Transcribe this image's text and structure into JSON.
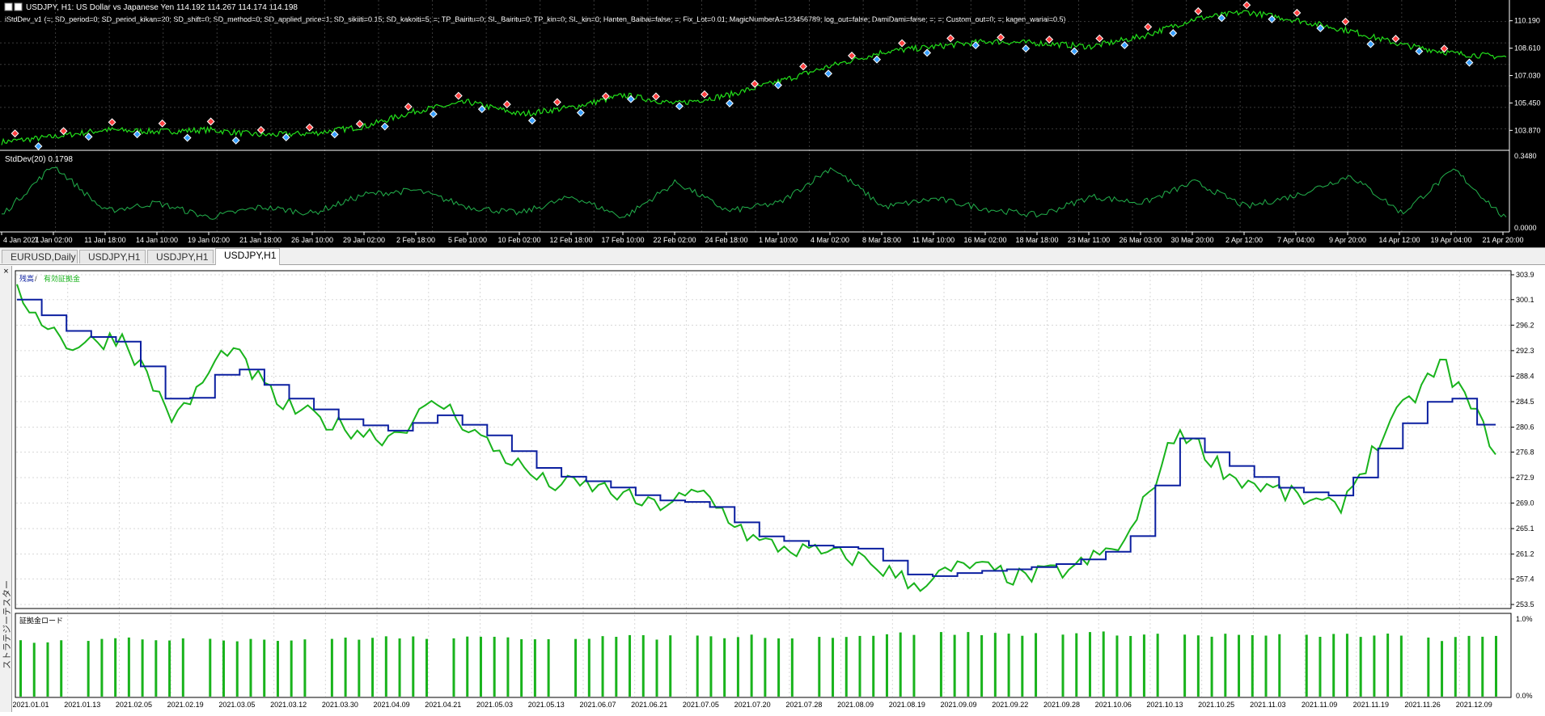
{
  "top_chart": {
    "header_line1": "USDJPY, H1:  US Dollar vs Japanese Yen  114.192 114.267 114.174 114.198",
    "header_line2": "iStdDev_v1 (=; SD_period=0; SD_period_kikan=20; SD_shift=0; SD_method=0; SD_applied_price=1; SD_sikiiti=0.15; SD_kakoiti=5; =; TP_Bairitu=0; SL_Bairitu=0; TP_kin=0; SL_kin=0; Hanten_Baibai=false; =; Fix_Lot=0.01; MagicNumberA=123456789; log_out=false; DamiDami=false; =; =; Custom_out=0; =; kagen_wariai=0.5)",
    "price_axis": [
      "110.190",
      "108.610",
      "107.030",
      "105.450",
      "103.870"
    ],
    "indicator_label": "StdDev(20) 0.1798",
    "indicator_axis": [
      "0.3480",
      "0.0000"
    ],
    "time_axis": [
      "4 Jan 2021",
      "7 Jan 02:00",
      "11 Jan 18:00",
      "14 Jan 10:00",
      "19 Jan 02:00",
      "21 Jan 18:00",
      "26 Jan 10:00",
      "29 Jan 02:00",
      "2 Feb 18:00",
      "5 Feb 10:00",
      "10 Feb 02:00",
      "12 Feb 18:00",
      "17 Feb 10:00",
      "22 Feb 02:00",
      "24 Feb 18:00",
      "1 Mar 10:00",
      "4 Mar 02:00",
      "8 Mar 18:00",
      "11 Mar 10:00",
      "16 Mar 02:00",
      "18 Mar 18:00",
      "23 Mar 11:00",
      "26 Mar 03:00",
      "30 Mar 20:00",
      "2 Apr 12:00",
      "7 Apr 04:00",
      "9 Apr 20:00",
      "14 Apr 12:00",
      "19 Apr 04:00",
      "21 Apr 20:00"
    ],
    "colors": {
      "price": "#22e01a",
      "indicator": "#22b14c",
      "grid": "#3a3a3a",
      "buy_marker": "#3aa0ff",
      "sell_marker": "#ff4040"
    }
  },
  "tabs": [
    {
      "label": "EURUSD,Daily",
      "active": false
    },
    {
      "label": "USDJPY,H1",
      "active": false
    },
    {
      "label": "USDJPY,H1",
      "active": false
    },
    {
      "label": "USDJPY,H1",
      "active": true
    }
  ],
  "tester_panel": {
    "close_label": "×",
    "side_label": "ストラテジーテスター"
  },
  "report": {
    "legend_balance": "残高",
    "legend_separator": " / ",
    "legend_equity": "有効証拠金",
    "y_axis": [
      "303.9",
      "300.1",
      "296.2",
      "292.3",
      "288.4",
      "284.5",
      "280.6",
      "276.8",
      "272.9",
      "269.0",
      "265.1",
      "261.2",
      "257.4",
      "253.5"
    ],
    "load_label": "証拠金ロード",
    "load_axis": [
      "1.0%",
      "0.0%"
    ],
    "x_axis": [
      "2021.01.01",
      "2021.01.13",
      "2021.02.05",
      "2021.02.19",
      "2021.03.05",
      "2021.03.12",
      "2021.03.30",
      "2021.04.09",
      "2021.04.21",
      "2021.05.03",
      "2021.05.13",
      "2021.06.07",
      "2021.06.21",
      "2021.07.05",
      "2021.07.20",
      "2021.07.28",
      "2021.08.09",
      "2021.08.19",
      "2021.09.09",
      "2021.09.22",
      "2021.09.28",
      "2021.10.06",
      "2021.10.13",
      "2021.10.25",
      "2021.11.03",
      "2021.11.09",
      "2021.11.19",
      "2021.11.26",
      "2021.12.09"
    ],
    "colors": {
      "balance": "#0b1fa0",
      "equity": "#19b31c",
      "load": "#19b31c",
      "grid": "#d8d8d8"
    }
  },
  "chart_data": [
    {
      "type": "line",
      "title": "USDJPY, H1",
      "ylim": [
        103.0,
        111.2
      ],
      "x": [
        "4 Jan 2021",
        "7 Jan 02:00",
        "11 Jan 18:00",
        "14 Jan 10:00",
        "19 Jan 02:00",
        "21 Jan 18:00",
        "26 Jan 10:00",
        "29 Jan 02:00",
        "2 Feb 18:00",
        "5 Feb 10:00",
        "10 Feb 02:00",
        "12 Feb 18:00",
        "17 Feb 10:00",
        "22 Feb 02:00",
        "24 Feb 18:00",
        "1 Mar 10:00",
        "4 Mar 02:00",
        "8 Mar 18:00",
        "11 Mar 10:00",
        "16 Mar 02:00",
        "18 Mar 18:00",
        "23 Mar 11:00",
        "26 Mar 03:00",
        "30 Mar 20:00",
        "2 Apr 12:00",
        "7 Apr 04:00",
        "9 Apr 20:00",
        "14 Apr 12:00",
        "19 Apr 04:00",
        "21 Apr 20:00"
      ],
      "series": [
        {
          "values": [
            103.2,
            103.5,
            103.9,
            103.8,
            103.9,
            103.6,
            103.7,
            104.1,
            105.0,
            105.5,
            104.8,
            105.2,
            105.9,
            105.4,
            105.9,
            106.7,
            107.6,
            108.4,
            108.7,
            109.0,
            108.9,
            108.7,
            109.3,
            110.3,
            110.7,
            110.2,
            109.6,
            108.8,
            108.3,
            108.1
          ]
        }
      ]
    },
    {
      "type": "line",
      "title": "StdDev(20) 0.1798",
      "ylim": [
        0,
        0.348
      ],
      "x": [
        "4 Jan 2021",
        "7 Jan 02:00",
        "11 Jan 18:00",
        "14 Jan 10:00",
        "19 Jan 02:00",
        "21 Jan 18:00",
        "26 Jan 10:00",
        "29 Jan 02:00",
        "2 Feb 18:00",
        "5 Feb 10:00",
        "10 Feb 02:00",
        "12 Feb 18:00",
        "17 Feb 10:00",
        "22 Feb 02:00",
        "24 Feb 18:00",
        "1 Mar 10:00",
        "4 Mar 02:00",
        "8 Mar 18:00",
        "11 Mar 10:00",
        "16 Mar 02:00",
        "18 Mar 18:00",
        "23 Mar 11:00",
        "26 Mar 03:00",
        "30 Mar 20:00",
        "2 Apr 12:00",
        "7 Apr 04:00",
        "9 Apr 20:00",
        "14 Apr 12:00",
        "19 Apr 04:00",
        "21 Apr 20:00"
      ],
      "series": [
        {
          "values": [
            0.06,
            0.3,
            0.08,
            0.12,
            0.05,
            0.1,
            0.07,
            0.16,
            0.18,
            0.1,
            0.07,
            0.15,
            0.05,
            0.22,
            0.08,
            0.12,
            0.29,
            0.1,
            0.14,
            0.09,
            0.06,
            0.15,
            0.12,
            0.22,
            0.1,
            0.16,
            0.25,
            0.07,
            0.28,
            0.04
          ]
        }
      ]
    },
    {
      "type": "line",
      "ylim": [
        253.5,
        303.9
      ],
      "x": [
        "2021.01.01",
        "2021.01.13",
        "2021.02.05",
        "2021.02.19",
        "2021.03.05",
        "2021.03.12",
        "2021.03.30",
        "2021.04.09",
        "2021.04.21",
        "2021.05.03",
        "2021.05.13",
        "2021.06.07",
        "2021.06.21",
        "2021.07.05",
        "2021.07.20",
        "2021.07.28",
        "2021.08.09",
        "2021.08.19",
        "2021.09.09",
        "2021.09.22",
        "2021.09.28",
        "2021.10.06",
        "2021.10.13",
        "2021.10.25",
        "2021.11.03",
        "2021.11.09",
        "2021.11.19",
        "2021.11.26",
        "2021.12.09"
      ],
      "series": [
        {
          "name": "残高",
          "values": [
            300.1,
            295.0,
            293.5,
            283.0,
            290.5,
            285.5,
            282.0,
            280.0,
            282.5,
            279.0,
            273.5,
            272.0,
            269.5,
            269.0,
            264.0,
            262.5,
            262.0,
            257.5,
            258.5,
            259.0,
            260.0,
            262.5,
            279.0,
            274.5,
            271.0,
            270.0,
            279.5,
            286.5,
            278.0
          ]
        },
        {
          "name": "有効証拠金",
          "values": [
            301.0,
            293.0,
            294.5,
            281.5,
            293.0,
            284.0,
            281.0,
            279.0,
            284.5,
            277.5,
            272.0,
            271.5,
            268.5,
            270.5,
            263.0,
            261.5,
            260.5,
            256.5,
            259.5,
            257.5,
            259.0,
            263.0,
            280.5,
            273.0,
            270.5,
            268.0,
            281.0,
            290.5,
            277.5
          ]
        }
      ]
    },
    {
      "type": "bar",
      "title": "証拠金ロード",
      "ylim": [
        0,
        1.0
      ],
      "categories": [
        "2021.01.01",
        "2021.01.13",
        "2021.02.05",
        "2021.02.19",
        "2021.03.05",
        "2021.03.12",
        "2021.03.30",
        "2021.04.09",
        "2021.04.21",
        "2021.05.03",
        "2021.05.13",
        "2021.06.07",
        "2021.06.21",
        "2021.07.05",
        "2021.07.20",
        "2021.07.28",
        "2021.08.09",
        "2021.08.19",
        "2021.09.09",
        "2021.09.22",
        "2021.09.28",
        "2021.10.06",
        "2021.10.13",
        "2021.10.25",
        "2021.11.03",
        "2021.11.09",
        "2021.11.19",
        "2021.11.26",
        "2021.12.09"
      ],
      "values": [
        0.72,
        0.75,
        0.74,
        0.76,
        0.75,
        0.74,
        0.76,
        0.77,
        0.75,
        0.76,
        0.77,
        0.78,
        0.77,
        0.78,
        0.79,
        0.78,
        0.8,
        0.82,
        0.82,
        0.81,
        0.82,
        0.82,
        0.8,
        0.8,
        0.79,
        0.8,
        0.8,
        0.75,
        0.78
      ]
    }
  ]
}
